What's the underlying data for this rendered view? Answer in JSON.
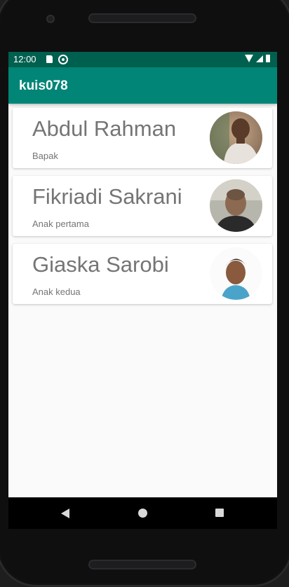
{
  "status_bar": {
    "time": "12:00",
    "icons": [
      "sd-card-icon",
      "sync-icon",
      "wifi-icon",
      "signal-icon",
      "battery-icon"
    ]
  },
  "app_bar": {
    "title": "kuis078",
    "color": "#008577"
  },
  "contacts": [
    {
      "name": "Abdul Rahman",
      "role": "Bapak",
      "avatar": "photo-avatar-icon"
    },
    {
      "name": "Fikriadi Sakrani",
      "role": "Anak pertama",
      "avatar": "photo-avatar-icon"
    },
    {
      "name": "Giaska Sarobi",
      "role": "Anak kedua",
      "avatar": "photo-avatar-icon"
    }
  ],
  "nav_bar": {
    "icons": [
      "back-icon",
      "home-icon",
      "recents-icon"
    ]
  },
  "colors": {
    "status_bar": "#00604f",
    "app_bar": "#008577",
    "text_secondary": "#757575",
    "background": "#fafafa"
  }
}
